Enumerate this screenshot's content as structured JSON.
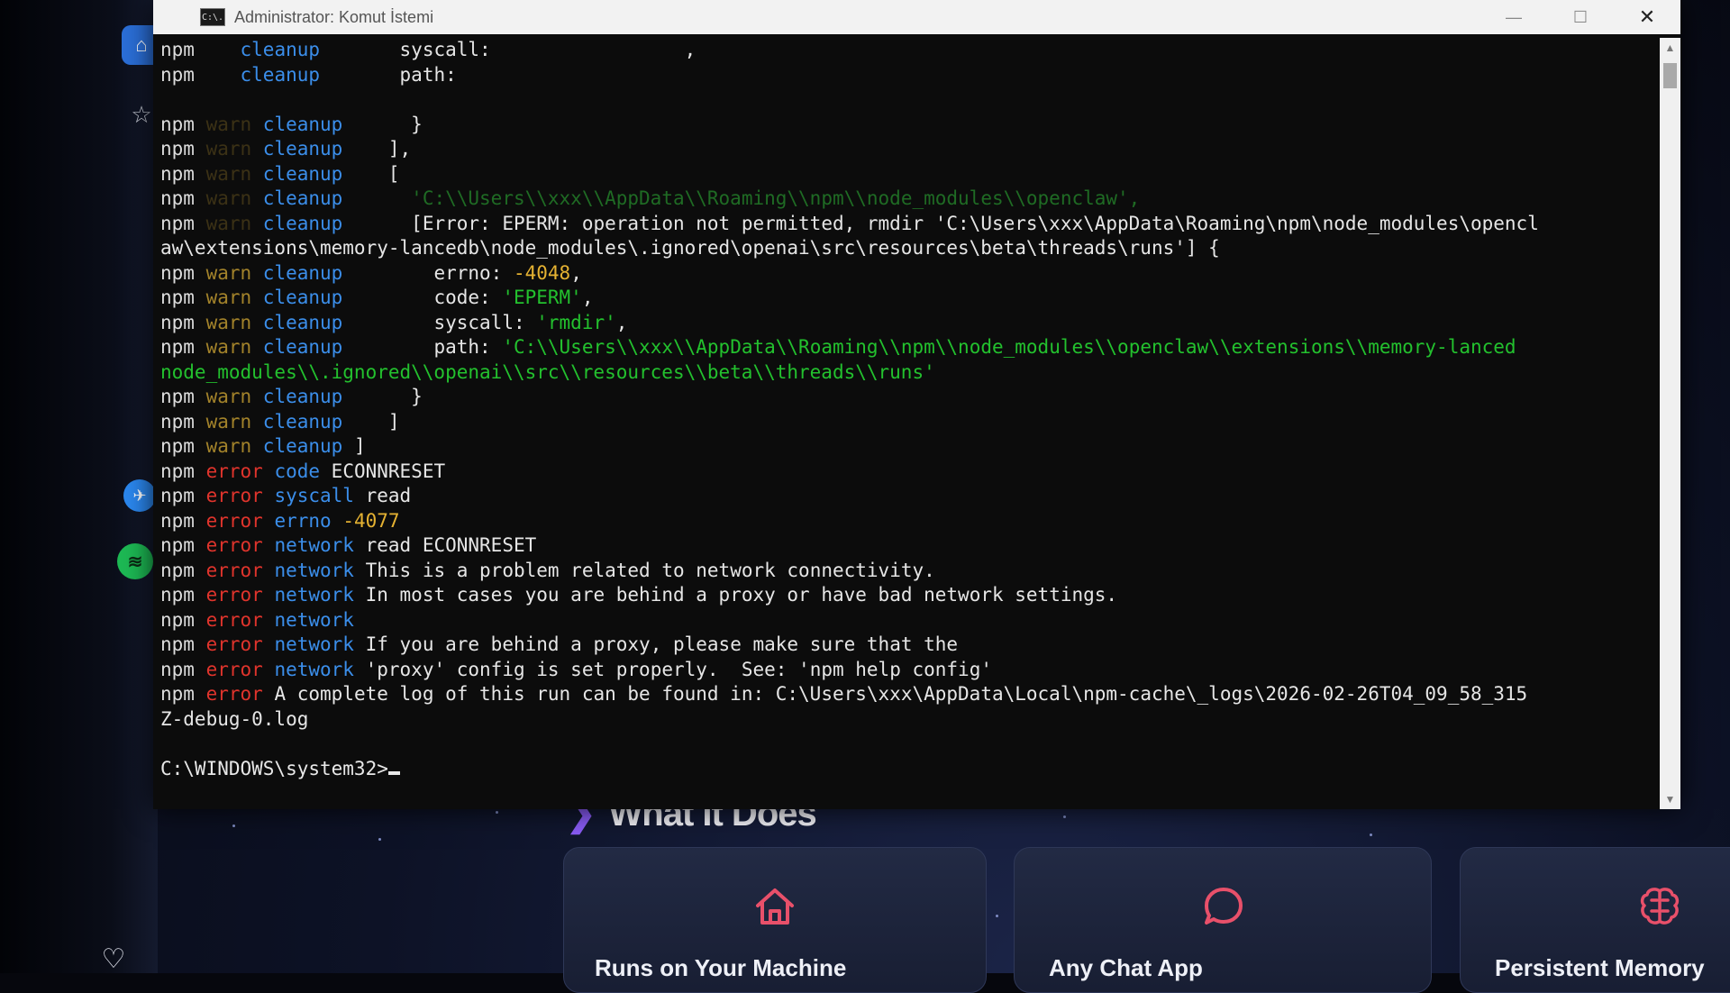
{
  "window": {
    "title": "Administrator: Komut İstemi",
    "icon_label": "C:\\.",
    "controls": {
      "minimize": "—",
      "maximize": "☐",
      "close": "✕"
    }
  },
  "console": {
    "lines": [
      [
        [
          "npm",
          "npm"
        ],
        [
          "warn dim",
          "    "
        ],
        [
          "tag",
          "cleanup"
        ],
        [
          "msg",
          "       syscall:                 ,"
        ]
      ],
      [
        [
          "npm",
          "npm"
        ],
        [
          "warn dim",
          "    "
        ],
        [
          "tag",
          "cleanup"
        ],
        [
          "msg",
          "       path:"
        ]
      ],
      [],
      [
        [
          "npm",
          "npm"
        ],
        [
          "warn dim",
          " warn "
        ],
        [
          "tag",
          "cleanup"
        ],
        [
          "msg",
          "      }"
        ]
      ],
      [
        [
          "npm",
          "npm"
        ],
        [
          "warn dim",
          " warn "
        ],
        [
          "tag",
          "cleanup"
        ],
        [
          "msg",
          "    ],"
        ]
      ],
      [
        [
          "npm",
          "npm"
        ],
        [
          "warn dim",
          " warn "
        ],
        [
          "tag",
          "cleanup"
        ],
        [
          "msg",
          "    ["
        ]
      ],
      [
        [
          "npm",
          "npm"
        ],
        [
          "warn dim",
          " warn "
        ],
        [
          "tag",
          "cleanup"
        ],
        [
          "dimstr",
          "      'C:\\\\Users\\\\xxx\\\\AppData\\\\Roaming\\\\npm\\\\node_modules\\\\openclaw',"
        ]
      ],
      [
        [
          "npm",
          "npm"
        ],
        [
          "warn dim",
          " warn "
        ],
        [
          "tag",
          "cleanup"
        ],
        [
          "msg",
          "      [Error: EPERM: operation not permitted, rmdir 'C:\\Users\\xxx\\AppData\\Roaming\\npm\\node_modules\\opencl"
        ]
      ],
      [
        [
          "msg",
          "aw\\extensions\\memory-lancedb\\node_modules\\.ignored\\openai\\src\\resources\\beta\\threads\\runs'] {"
        ]
      ],
      [
        [
          "npm",
          "npm"
        ],
        [
          "warn",
          " warn "
        ],
        [
          "tag",
          "cleanup"
        ],
        [
          "msg",
          "        errno: "
        ],
        [
          "num",
          "-4048"
        ],
        [
          "msg",
          ","
        ]
      ],
      [
        [
          "npm",
          "npm"
        ],
        [
          "warn",
          " warn "
        ],
        [
          "tag",
          "cleanup"
        ],
        [
          "msg",
          "        code: "
        ],
        [
          "str",
          "'EPERM'"
        ],
        [
          "msg",
          ","
        ]
      ],
      [
        [
          "npm",
          "npm"
        ],
        [
          "warn",
          " warn "
        ],
        [
          "tag",
          "cleanup"
        ],
        [
          "msg",
          "        syscall: "
        ],
        [
          "str",
          "'rmdir'"
        ],
        [
          "msg",
          ","
        ]
      ],
      [
        [
          "npm",
          "npm"
        ],
        [
          "warn",
          " warn "
        ],
        [
          "tag",
          "cleanup"
        ],
        [
          "msg",
          "        path: "
        ],
        [
          "str",
          "'C:\\\\Users\\\\xxx\\\\AppData\\\\Roaming\\\\npm\\\\node_modules\\\\openclaw\\\\extensions\\\\memory-lanced"
        ]
      ],
      [
        [
          "str",
          "node_modules\\\\.ignored\\\\openai\\\\src\\\\resources\\\\beta\\\\threads\\\\runs'"
        ]
      ],
      [
        [
          "npm",
          "npm"
        ],
        [
          "warn",
          " warn "
        ],
        [
          "tag",
          "cleanup"
        ],
        [
          "msg",
          "      }"
        ]
      ],
      [
        [
          "npm",
          "npm"
        ],
        [
          "warn",
          " warn "
        ],
        [
          "tag",
          "cleanup"
        ],
        [
          "msg",
          "    ]"
        ]
      ],
      [
        [
          "npm",
          "npm"
        ],
        [
          "warn",
          " warn "
        ],
        [
          "tag",
          "cleanup"
        ],
        [
          "msg",
          " ]"
        ]
      ],
      [
        [
          "npm",
          "npm"
        ],
        [
          "err",
          " error "
        ],
        [
          "tag",
          "code"
        ],
        [
          "msg",
          " ECONNRESET"
        ]
      ],
      [
        [
          "npm",
          "npm"
        ],
        [
          "err",
          " error "
        ],
        [
          "tag",
          "syscall"
        ],
        [
          "msg",
          " read"
        ]
      ],
      [
        [
          "npm",
          "npm"
        ],
        [
          "err",
          " error "
        ],
        [
          "tag",
          "errno"
        ],
        [
          "msg",
          " "
        ],
        [
          "num",
          "-4077"
        ]
      ],
      [
        [
          "npm",
          "npm"
        ],
        [
          "err",
          " error "
        ],
        [
          "tag",
          "network"
        ],
        [
          "msg",
          " read ECONNRESET"
        ]
      ],
      [
        [
          "npm",
          "npm"
        ],
        [
          "err",
          " error "
        ],
        [
          "tag",
          "network"
        ],
        [
          "msg",
          " This is a problem related to network connectivity."
        ]
      ],
      [
        [
          "npm",
          "npm"
        ],
        [
          "err",
          " error "
        ],
        [
          "tag",
          "network"
        ],
        [
          "msg",
          " In most cases you are behind a proxy or have bad network settings."
        ]
      ],
      [
        [
          "npm",
          "npm"
        ],
        [
          "err",
          " error "
        ],
        [
          "tag",
          "network"
        ]
      ],
      [
        [
          "npm",
          "npm"
        ],
        [
          "err",
          " error "
        ],
        [
          "tag",
          "network"
        ],
        [
          "msg",
          " If you are behind a proxy, please make sure that the"
        ]
      ],
      [
        [
          "npm",
          "npm"
        ],
        [
          "err",
          " error "
        ],
        [
          "tag",
          "network"
        ],
        [
          "msg",
          " 'proxy' config is set properly.  See: 'npm help config'"
        ]
      ],
      [
        [
          "npm",
          "npm"
        ],
        [
          "err",
          " error "
        ],
        [
          "msg",
          "A complete log of this run can be found in: C:\\Users\\xxx\\AppData\\Local\\npm-cache\\_logs\\2026-02-26T04_09_58_315"
        ]
      ],
      [
        [
          "msg",
          "Z-debug-0.log"
        ]
      ],
      [],
      [
        [
          "prompt",
          "C:\\WINDOWS\\system32>"
        ]
      ]
    ]
  },
  "webpage": {
    "section_title": "What It Does",
    "cards": [
      {
        "title": "Runs on Your Machine",
        "icon": "house-icon"
      },
      {
        "title": "Any Chat App",
        "icon": "chat-bubble-icon"
      },
      {
        "title": "Persistent Memory",
        "icon": "brain-icon"
      }
    ],
    "accent_color": "#e8506a"
  },
  "dock": {
    "icons": [
      "app-blue-icon",
      "star-icon",
      "messenger-icon",
      "spotify-icon",
      "heart-icon"
    ]
  },
  "colors": {
    "console_bg": "#0c0c0c",
    "npm_warn": "#c8a032",
    "npm_error": "#e0342c",
    "npm_tag": "#3b8eea",
    "string": "#23c12e",
    "number": "#e5b232"
  }
}
